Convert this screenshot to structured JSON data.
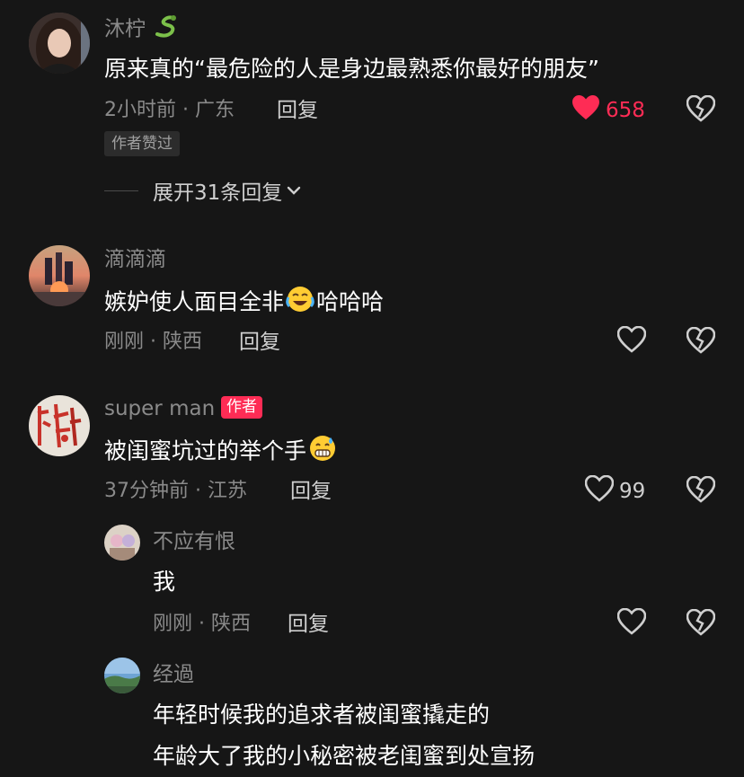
{
  "comments": [
    {
      "author": "沐柠",
      "text_before": "原来真的“最危险的人是身边最熟悉你最好的朋友”",
      "meta": "2小时前 · 广东",
      "reply_label": "回复",
      "like_count": "658",
      "liked": true,
      "badge": "作者赞过",
      "expand_label": "展开31条回复",
      "icons": [
        "snake-icon",
        "heart-filled-icon",
        "broken-heart-icon",
        "chevron-down-icon"
      ]
    },
    {
      "author": "滴滴滴",
      "text_before": "嫉妒使人面目全非",
      "text_after": "哈哈哈",
      "meta": "刚刚 · 陕西",
      "reply_label": "回复",
      "liked": false,
      "icons": [
        "crying-laughing-emoji",
        "heart-outline-icon",
        "broken-heart-icon"
      ]
    },
    {
      "author": "super man",
      "author_badge": "作者",
      "text_before": "被闺蜜坑过的举个手",
      "meta": "37分钟前 · 江苏",
      "reply_label": "回复",
      "like_count": "99",
      "liked": false,
      "icons": [
        "grimacing-sweat-emoji",
        "heart-outline-icon",
        "broken-heart-icon"
      ]
    },
    {
      "author": "不应有恨",
      "text_before": "我",
      "meta": "刚刚 · 陕西",
      "reply_label": "回复",
      "liked": false,
      "icons": [
        "heart-outline-icon",
        "broken-heart-icon"
      ]
    },
    {
      "author": "经過",
      "text_line1": "年轻时候我的追求者被闺蜜撬走的",
      "text_line2": "年龄大了我的小秘密被老闺蜜到处宣扬"
    }
  ],
  "colors": {
    "background": "#161616",
    "like_active": "#fe2c55",
    "author_badge": "#fe2c55",
    "secondary_text": "#8a8a8a"
  }
}
